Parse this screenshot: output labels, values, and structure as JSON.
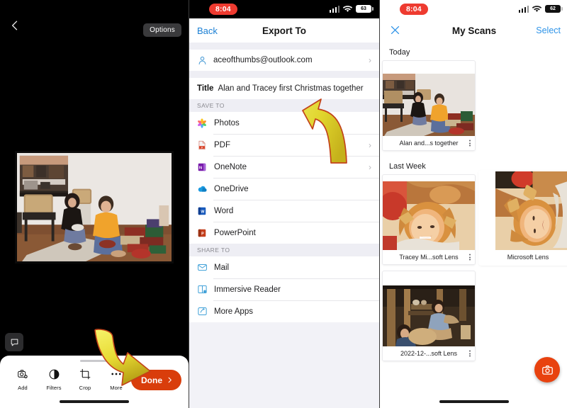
{
  "editor": {
    "back_icon": "chevron-left-icon",
    "options_label": "Options",
    "note_icon": "text-annotation-icon",
    "tools": [
      {
        "icon": "add-photo-icon",
        "label": "Add"
      },
      {
        "icon": "filters-icon",
        "label": "Filters"
      },
      {
        "icon": "crop-icon",
        "label": "Crop"
      },
      {
        "icon": "more-icon",
        "label": "More"
      }
    ],
    "done_label": "Done",
    "done_chevron": "chevron-right-icon",
    "done_color": "#d93d0b"
  },
  "export": {
    "status": {
      "time": "8:04",
      "battery": "63",
      "signal_icon": "cellular-bars-icon",
      "wifi_icon": "wifi-icon",
      "battery_icon": "battery-icon"
    },
    "nav": {
      "back_label": "Back",
      "title": "Export To"
    },
    "account": {
      "icon": "person-icon",
      "email": "aceofthumbs@outlook.com",
      "chevron": "chevron-right-icon"
    },
    "title_field": {
      "label": "Title",
      "value": "Alan and Tracey first Christmas together"
    },
    "save_to_header": "SAVE TO",
    "save_to": [
      {
        "icon": "photos-icon",
        "label": "Photos",
        "chevron": false
      },
      {
        "icon": "pdf-icon",
        "label": "PDF",
        "chevron": true
      },
      {
        "icon": "onenote-icon",
        "label": "OneNote",
        "chevron": true
      },
      {
        "icon": "onedrive-icon",
        "label": "OneDrive",
        "chevron": false
      },
      {
        "icon": "word-icon",
        "label": "Word",
        "chevron": false
      },
      {
        "icon": "powerpoint-icon",
        "label": "PowerPoint",
        "chevron": false
      }
    ],
    "share_to_header": "SHARE TO",
    "share_to": [
      {
        "icon": "mail-icon",
        "label": "Mail"
      },
      {
        "icon": "immersive-reader-icon",
        "label": "Immersive Reader"
      },
      {
        "icon": "more-apps-icon",
        "label": "More Apps"
      }
    ]
  },
  "scans": {
    "status": {
      "time": "8:04",
      "battery": "62",
      "signal_icon": "cellular-bars-icon",
      "wifi_icon": "wifi-icon",
      "battery_icon": "battery-icon"
    },
    "nav": {
      "close_icon": "close-x-icon",
      "title": "My Scans",
      "select_label": "Select"
    },
    "sections": [
      {
        "label": "Today",
        "items": [
          {
            "caption": "Alan and...s together",
            "kebab": "kebab-menu-icon",
            "thumb": "living-room-christmas-photo"
          }
        ]
      },
      {
        "label": "Last Week",
        "items": [
          {
            "caption": "Tracey Mi...soft Lens",
            "kebab": "kebab-menu-icon",
            "thumb": "girl-eating-portrait-photo"
          },
          {
            "caption": "Microsoft Lens",
            "kebab": "kebab-menu-icon",
            "thumb": "girl-eating-portrait-photo-rotated"
          },
          {
            "caption": "2022-12-...soft Lens",
            "kebab": "kebab-menu-icon",
            "thumb": "cabin-interior-photo"
          }
        ]
      }
    ],
    "fab": {
      "icon": "camera-icon",
      "color": "#e8420f"
    }
  },
  "annotations": {
    "arrow_color_top": "#f4ef5a",
    "arrow_color_bottom": "#b8a61a",
    "arrow_stroke": "#c2421a",
    "arrow_export_name": "curved-arrow-to-title-field",
    "arrow_done_name": "curved-arrow-to-done-button"
  }
}
